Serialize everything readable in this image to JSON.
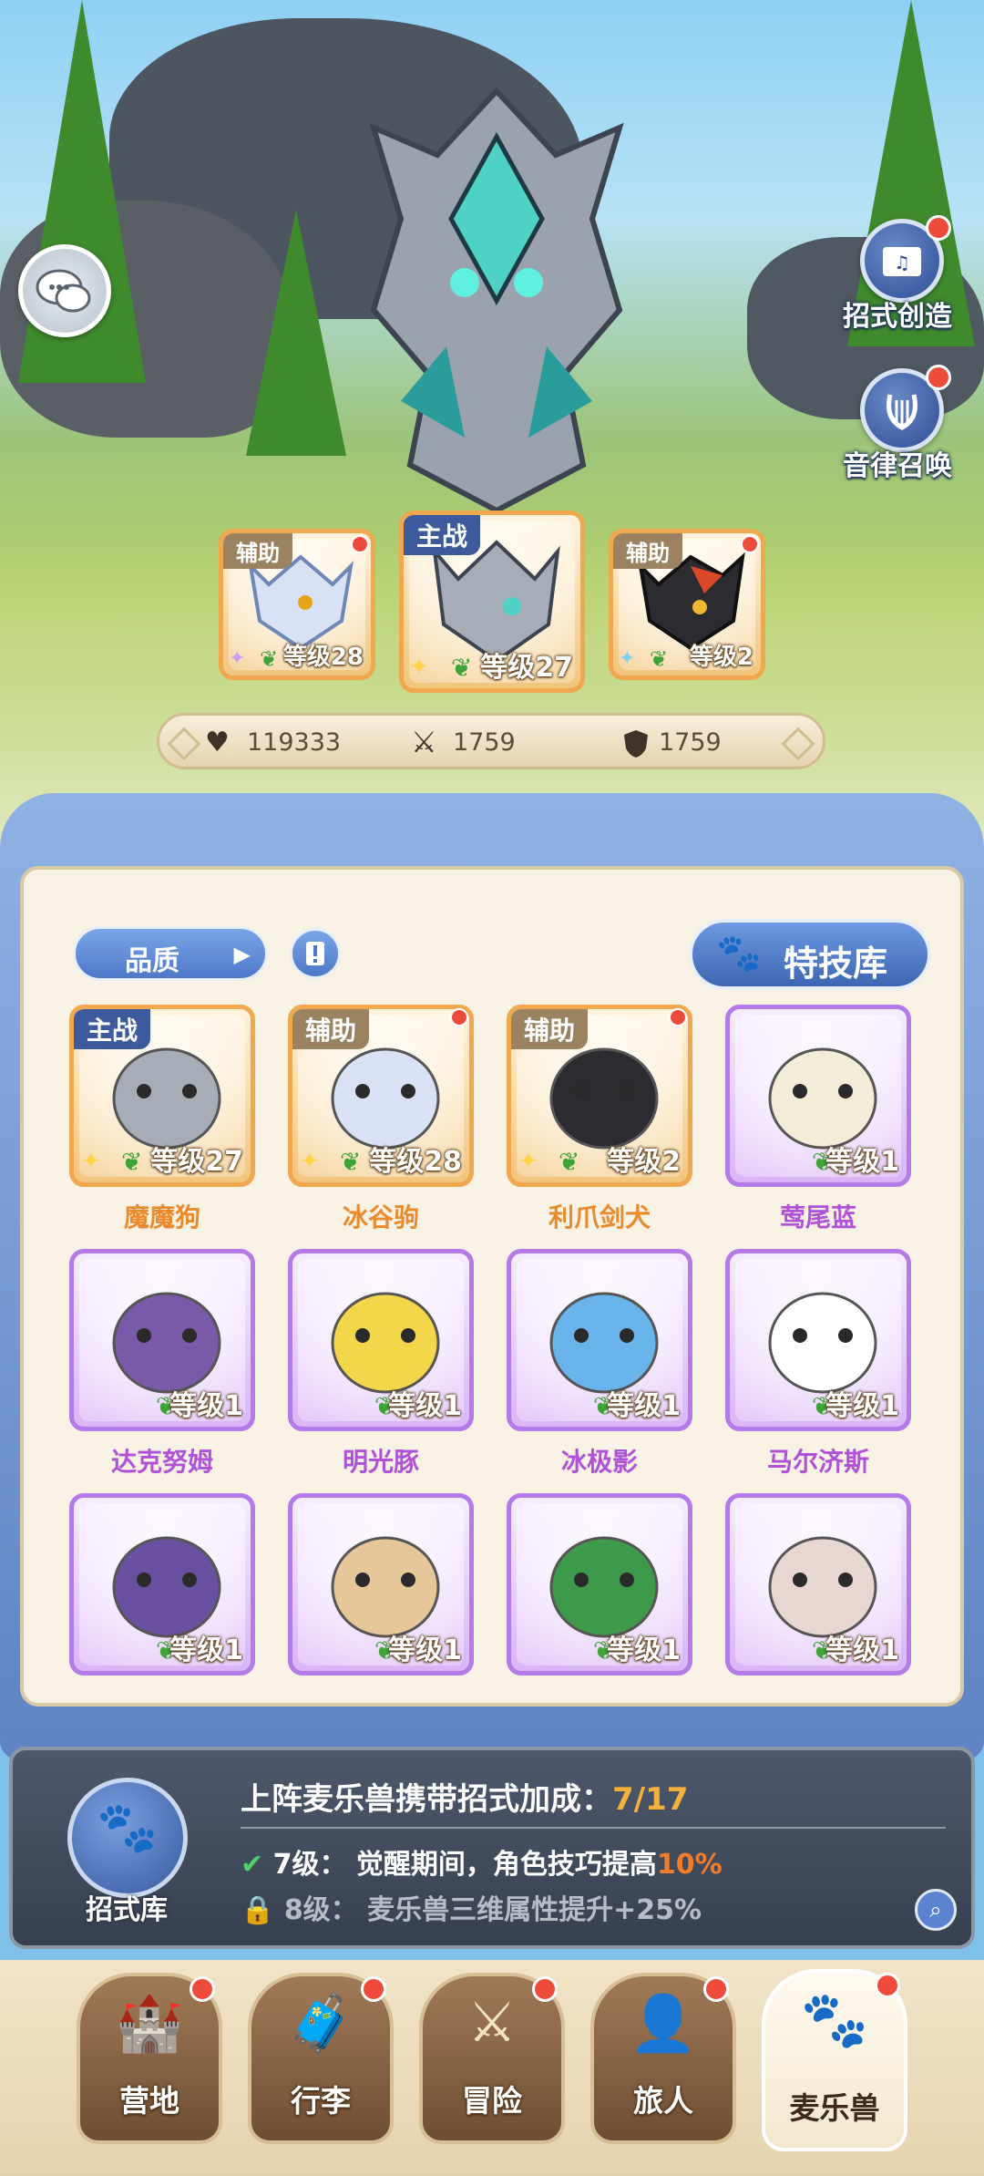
{
  "side_buttons": [
    {
      "label": "招式创造"
    },
    {
      "label": "音律召唤"
    }
  ],
  "team": [
    {
      "role": "辅助",
      "level": "等级28",
      "type": "orange"
    },
    {
      "role": "主战",
      "level": "等级27",
      "type": "orange"
    },
    {
      "role": "辅助",
      "level": "等级2",
      "type": "orange"
    }
  ],
  "stats": {
    "hp": "119333",
    "attack": "1759",
    "defense": "1759"
  },
  "filter": {
    "quality_label": "品质",
    "skill_library_label": "特技库"
  },
  "monsters": [
    {
      "name": "魔魔狗",
      "level": "等级27",
      "role": "主战",
      "type": "orange"
    },
    {
      "name": "冰谷驹",
      "level": "等级28",
      "role": "辅助",
      "type": "orange"
    },
    {
      "name": "利爪剑犬",
      "level": "等级2",
      "role": "辅助",
      "type": "orange"
    },
    {
      "name": "莺尾蓝",
      "level": "等级1",
      "role": "",
      "type": "purple"
    },
    {
      "name": "达克努姆",
      "level": "等级1",
      "role": "",
      "type": "purple"
    },
    {
      "name": "明光豚",
      "level": "等级1",
      "role": "",
      "type": "purple"
    },
    {
      "name": "冰极影",
      "level": "等级1",
      "role": "",
      "type": "purple"
    },
    {
      "name": "马尔济斯",
      "level": "等级1",
      "role": "",
      "type": "purple"
    },
    {
      "name": "",
      "level": "等级1",
      "role": "",
      "type": "purple"
    },
    {
      "name": "",
      "level": "等级1",
      "role": "",
      "type": "purple"
    },
    {
      "name": "",
      "level": "等级1",
      "role": "",
      "type": "purple"
    },
    {
      "name": "",
      "level": "等级1",
      "role": "",
      "type": "purple"
    }
  ],
  "skill_bonus": {
    "icon_label": "招式库",
    "title": "上阵麦乐兽携带招式加成：",
    "progress": "7/17",
    "rows": [
      {
        "level": "7级：",
        "text": "觉醒期间，角色技巧提高",
        "value": "10%",
        "unlocked": true
      },
      {
        "level": "8级：",
        "text": "麦乐兽三维属性提升+25%",
        "value": "",
        "unlocked": false
      }
    ]
  },
  "nav": [
    {
      "label": "营地",
      "active": false
    },
    {
      "label": "行李",
      "active": false
    },
    {
      "label": "冒险",
      "active": false
    },
    {
      "label": "旅人",
      "active": false
    },
    {
      "label": "麦乐兽",
      "active": true
    }
  ],
  "colors": {
    "accent_blue": "#3c5a9c",
    "orange_rarity": "#f0a84e",
    "purple_rarity": "#b47ae8",
    "badge_red": "#ee4b3c",
    "highlight": "#f07d2a"
  }
}
